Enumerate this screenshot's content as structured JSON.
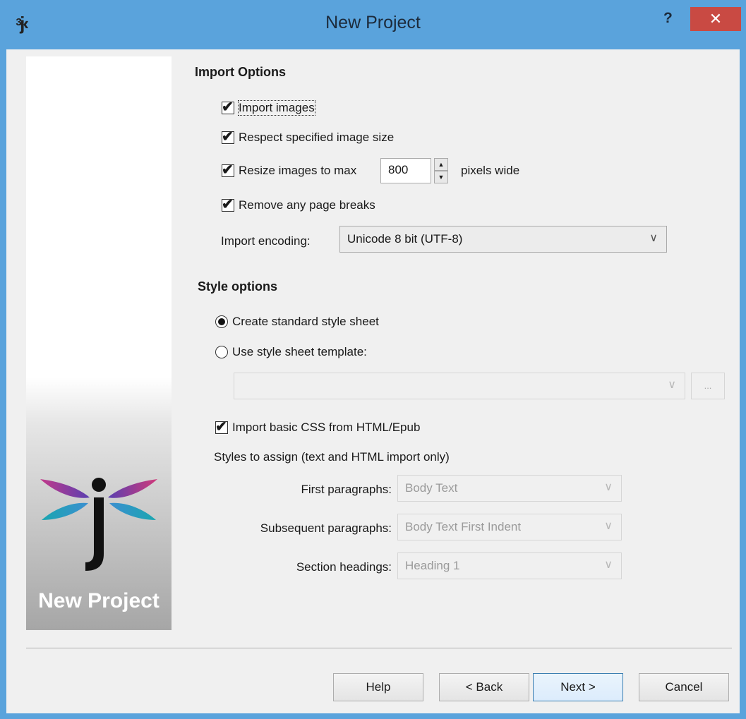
{
  "window": {
    "title": "New Project",
    "help_symbol": "?",
    "close_symbol": "✕"
  },
  "side_panel": {
    "caption": "New Project"
  },
  "import_options": {
    "heading": "Import Options",
    "import_images": {
      "label": "Import images",
      "checked": true
    },
    "respect_size": {
      "label": "Respect specified image size",
      "checked": true
    },
    "resize": {
      "label": "Resize images to max",
      "checked": true,
      "value": "800",
      "suffix": "pixels wide"
    },
    "remove_breaks": {
      "label": "Remove any page breaks",
      "checked": true
    },
    "encoding": {
      "label": "Import encoding:",
      "value": "Unicode 8 bit (UTF-8)"
    }
  },
  "style_options": {
    "heading": "Style options",
    "create_standard": {
      "label": "Create standard style sheet",
      "selected": true
    },
    "use_template": {
      "label": "Use style sheet template:",
      "selected": false
    },
    "template_value": "",
    "browse_label": "...",
    "import_css": {
      "label": "Import basic CSS from HTML/Epub",
      "checked": true
    },
    "assign_heading": "Styles to assign (text and HTML import only)",
    "first_paragraphs": {
      "label": "First paragraphs:",
      "value": "Body Text"
    },
    "subsequent_paragraphs": {
      "label": "Subsequent paragraphs:",
      "value": "Body Text First Indent"
    },
    "section_headings": {
      "label": "Section headings:",
      "value": "Heading 1"
    }
  },
  "buttons": {
    "help": "Help",
    "back": "< Back",
    "next": "Next >",
    "cancel": "Cancel"
  }
}
